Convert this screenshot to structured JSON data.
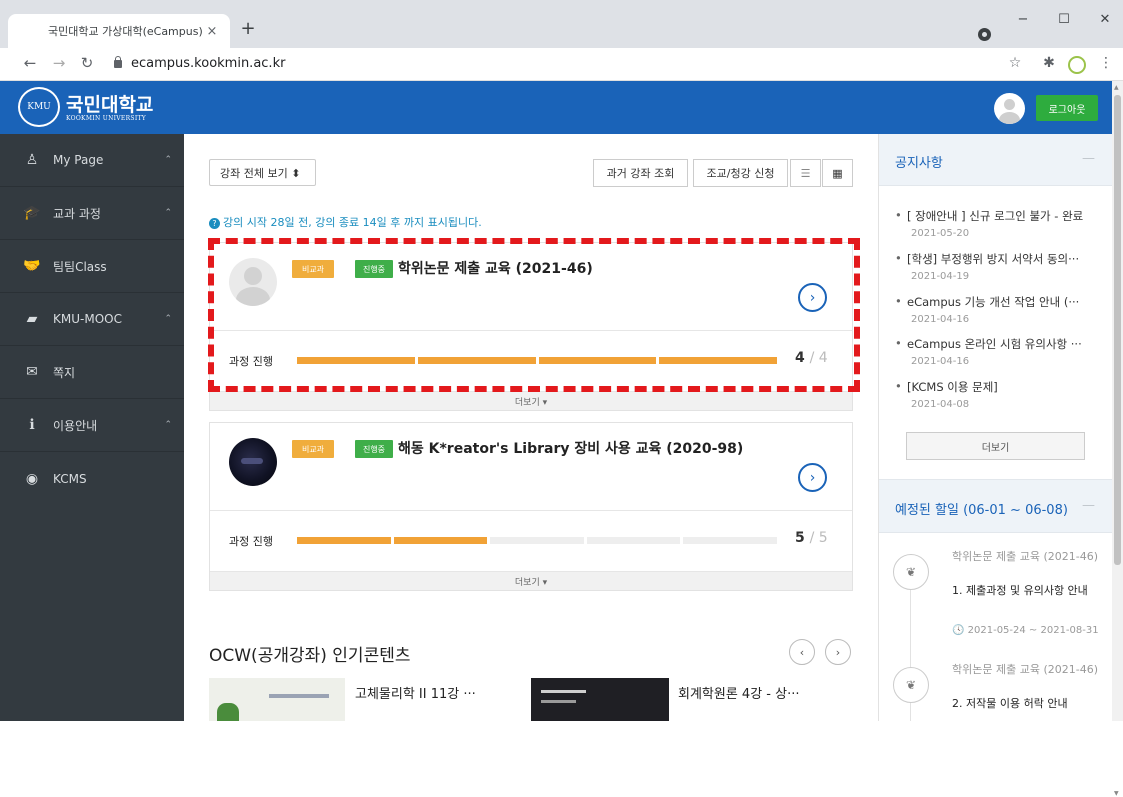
{
  "browser": {
    "tab_title": "국민대학교 가상대학(eCampus)",
    "tab_close": "×",
    "new_tab": "+",
    "url": "ecampus.kookmin.ac.kr",
    "win_min": "−",
    "win_max": "☐",
    "win_close": "✕"
  },
  "header": {
    "logo_emblem": "KMU",
    "logo_kr": "국민대학교",
    "logo_en": "KOOKMIN UNIVERSITY",
    "logout_label": "로그아웃"
  },
  "sidebar": {
    "items": [
      {
        "label": "My Page",
        "icon": "user-icon",
        "glyph": "♙",
        "chevron": "⌃"
      },
      {
        "label": "교과 과정",
        "icon": "graduation-cap-icon",
        "glyph": "🎓",
        "chevron": "⌃"
      },
      {
        "label": "팀팀Class",
        "icon": "handshake-icon",
        "glyph": "🤝",
        "chevron": ""
      },
      {
        "label": "KMU-MOOC",
        "icon": "book-icon",
        "glyph": "▰",
        "chevron": "⌃"
      },
      {
        "label": "쪽지",
        "icon": "envelope-icon",
        "glyph": "✉",
        "chevron": ""
      },
      {
        "label": "이용안내",
        "icon": "info-icon",
        "glyph": "ℹ",
        "chevron": "⌃"
      },
      {
        "label": "KCMS",
        "icon": "play-circle-icon",
        "glyph": "◉",
        "chevron": ""
      }
    ]
  },
  "main": {
    "view_select": "강좌 전체 보기 ⬍",
    "past_courses": "과거 강좌 조회",
    "ta_apply": "조교/청강 신청",
    "info_text": "강의 시작 28일 전, 강의 종료 14일 후 까지 표시됩니다.",
    "courses": [
      {
        "badge_type": "비교과",
        "badge_status": "진행중",
        "title": "학위논문 제출 교육 (2021-46)",
        "progress_label": "과정 진행",
        "done": "4",
        "total": "/ 4",
        "progress_fraction": 1.0,
        "more": "더보기 ▾"
      },
      {
        "badge_type": "비교과",
        "badge_status": "진행중",
        "title": "해동 K*reator's Library 장비 사용 교육 (2020-98)",
        "progress_label": "과정 진행",
        "done": "5",
        "total": "/ 5",
        "progress_fraction": 0.4,
        "more": "더보기 ▾"
      }
    ],
    "ocw": {
      "title": "OCW(공개강좌) 인기콘텐츠",
      "items": [
        {
          "caption": "고체물리학 II 11강 ···"
        },
        {
          "caption": "회계학원론 4강 - 상···"
        }
      ]
    }
  },
  "notices": {
    "title": "공지사항",
    "items": [
      {
        "text": "[ 장애안내 ] 신규 로그인 불가 - 완료",
        "date": "2021-05-20"
      },
      {
        "text": "[학생] 부정행위 방지 서약서 동의···",
        "date": "2021-04-19"
      },
      {
        "text": "eCampus 기능 개선 작업 안내 (···",
        "date": "2021-04-16"
      },
      {
        "text": "eCampus 온라인 시험 유의사항 ···",
        "date": "2021-04-16"
      },
      {
        "text": "[KCMS 이용 문제]",
        "date": "2021-04-08"
      }
    ],
    "more": "더보기"
  },
  "schedule": {
    "title": "예정된 할일 (06-01 ~ 06-08)",
    "items": [
      {
        "course": "학위논문 제출 교육 (2021-46)",
        "name": "1. 제출과정 및 유의사항 안내",
        "date": "🕓 2021-05-24 ~ 2021-08-31"
      },
      {
        "course": "학위논문 제출 교육 (2021-46)",
        "name": "2. 저작물 이용 허락 안내",
        "date": ""
      }
    ]
  }
}
